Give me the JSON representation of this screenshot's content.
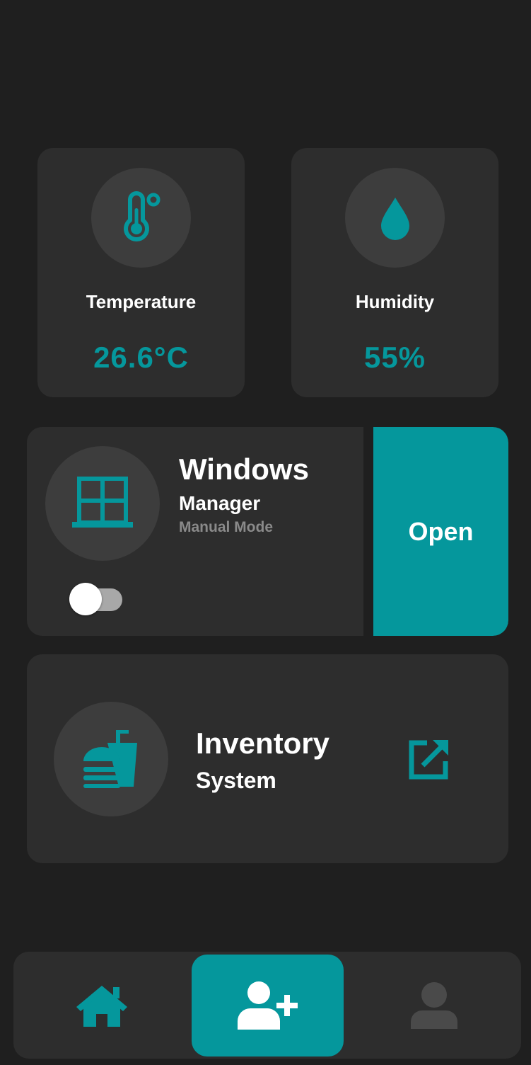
{
  "colors": {
    "background": "#1f1f1f",
    "card": "#2d2d2d",
    "circle": "#3d3d3d",
    "accent": "#05979c",
    "muted_text": "#8a8a8a",
    "inactive_icon": "#4a4a4a"
  },
  "sensors": [
    {
      "label": "Temperature",
      "value": "26.6°C",
      "icon": "thermometer-icon"
    },
    {
      "label": "Humidity",
      "value": "55%",
      "icon": "water-drop-icon"
    }
  ],
  "windows": {
    "title": "Windows",
    "subtitle": "Manager",
    "mode": "Manual Mode",
    "icon": "window-icon",
    "action_label": "Open",
    "auto_toggle_on": false
  },
  "inventory": {
    "title": "Inventory",
    "subtitle": "System",
    "icon": "fast-food-icon",
    "link_icon": "external-link-icon"
  },
  "bottom_nav": [
    {
      "name": "home",
      "icon": "home-icon",
      "active": false
    },
    {
      "name": "add-user",
      "icon": "add-user-icon",
      "active": true
    },
    {
      "name": "profile",
      "icon": "user-icon",
      "active": false
    }
  ]
}
